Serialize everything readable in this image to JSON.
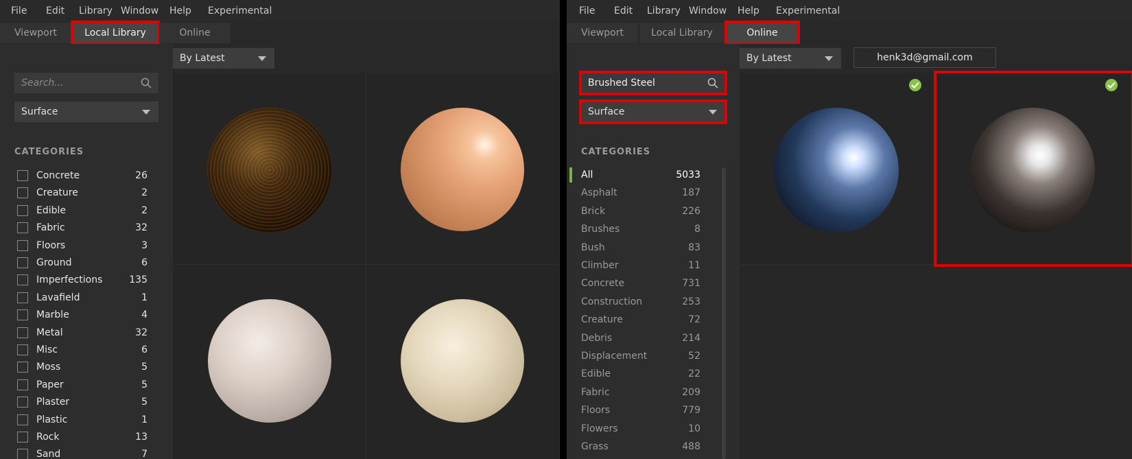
{
  "menu": [
    "File",
    "Edit",
    "Library",
    "Window",
    "Help",
    "Experimental"
  ],
  "left": {
    "tabs": [
      "Viewport",
      "Local Library",
      "Online"
    ],
    "sort": "By Latest",
    "search_placeholder": "Search...",
    "filter": "Surface",
    "categories_title": "CATEGORIES",
    "categories": [
      {
        "label": "Concrete",
        "count": "26"
      },
      {
        "label": "Creature",
        "count": "2"
      },
      {
        "label": "Edible",
        "count": "2"
      },
      {
        "label": "Fabric",
        "count": "32"
      },
      {
        "label": "Floors",
        "count": "3"
      },
      {
        "label": "Ground",
        "count": "6"
      },
      {
        "label": "Imperfections",
        "count": "135"
      },
      {
        "label": "Lavafield",
        "count": "1"
      },
      {
        "label": "Marble",
        "count": "4"
      },
      {
        "label": "Metal",
        "count": "32"
      },
      {
        "label": "Misc",
        "count": "6"
      },
      {
        "label": "Moss",
        "count": "5"
      },
      {
        "label": "Paper",
        "count": "5"
      },
      {
        "label": "Plaster",
        "count": "5"
      },
      {
        "label": "Plastic",
        "count": "1"
      },
      {
        "label": "Rock",
        "count": "13"
      },
      {
        "label": "Sand",
        "count": "7"
      }
    ]
  },
  "right": {
    "tabs": [
      "Viewport",
      "Local Library",
      "Online"
    ],
    "sort": "By Latest",
    "account": "henk3d@gmail.com",
    "search_value": "Brushed Steel",
    "filter": "Surface",
    "categories_title": "CATEGORIES",
    "categories": [
      {
        "label": "All",
        "count": "5033"
      },
      {
        "label": "Asphalt",
        "count": "187"
      },
      {
        "label": "Brick",
        "count": "226"
      },
      {
        "label": "Brushes",
        "count": "8"
      },
      {
        "label": "Bush",
        "count": "83"
      },
      {
        "label": "Climber",
        "count": "11"
      },
      {
        "label": "Concrete",
        "count": "731"
      },
      {
        "label": "Construction",
        "count": "253"
      },
      {
        "label": "Creature",
        "count": "72"
      },
      {
        "label": "Debris",
        "count": "214"
      },
      {
        "label": "Displacement",
        "count": "52"
      },
      {
        "label": "Edible",
        "count": "22"
      },
      {
        "label": "Fabric",
        "count": "209"
      },
      {
        "label": "Floors",
        "count": "779"
      },
      {
        "label": "Flowers",
        "count": "10"
      },
      {
        "label": "Grass",
        "count": "488"
      }
    ]
  },
  "colors": {
    "highlight": "#e10000",
    "check": "#8bc34a",
    "active_bar": "#7cb342"
  }
}
